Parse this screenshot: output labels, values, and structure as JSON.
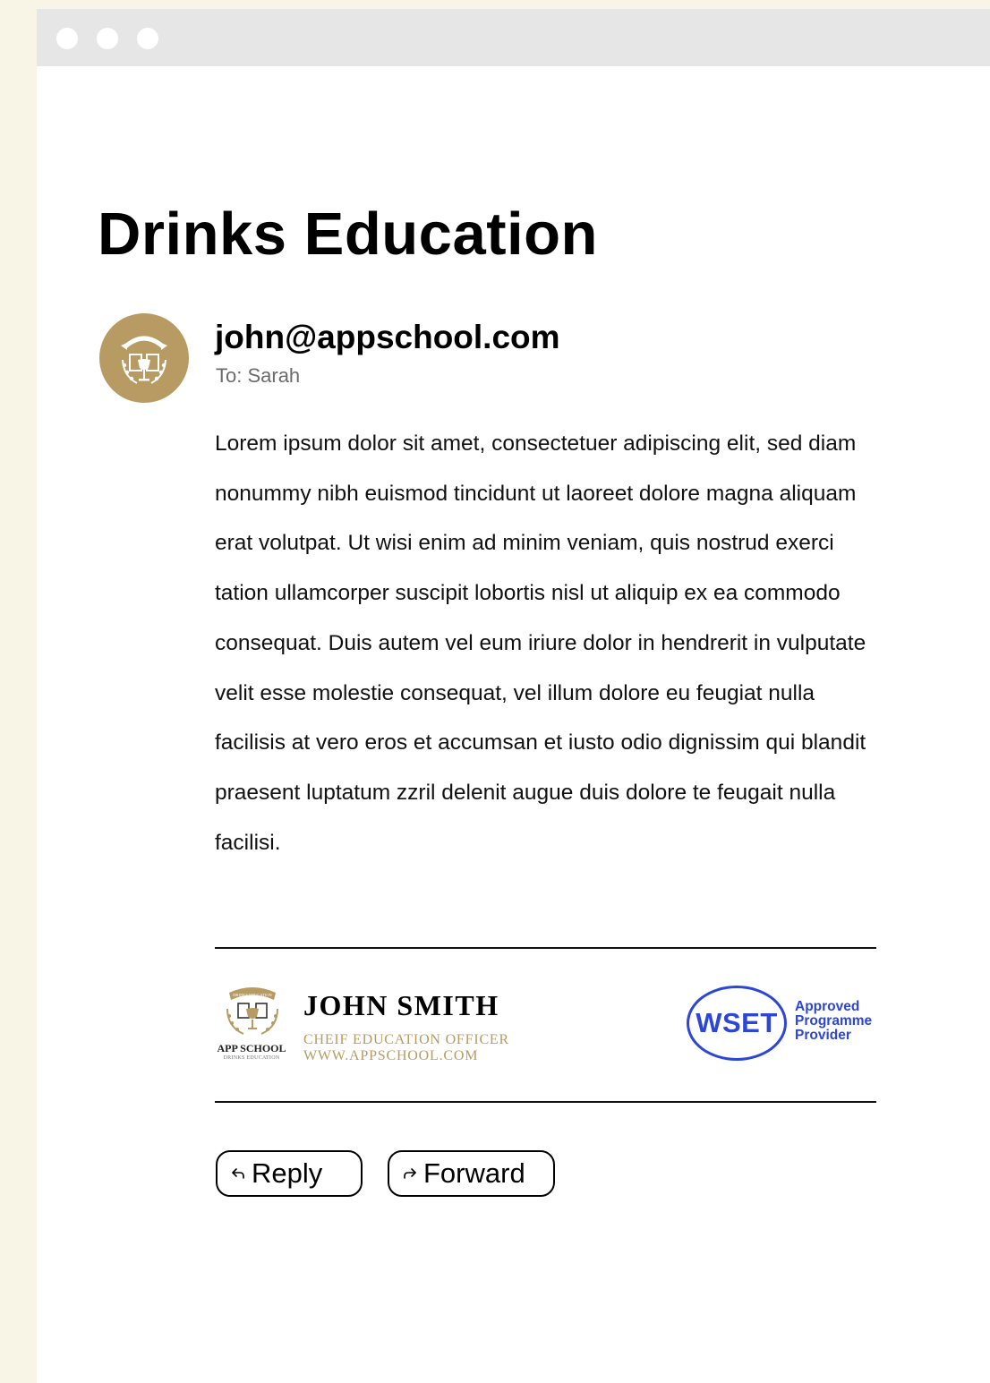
{
  "window": {
    "controls": [
      "window-dot",
      "window-dot",
      "window-dot"
    ]
  },
  "email": {
    "subject": "Drinks Education",
    "avatar_icon": "app-school-crest-icon",
    "sender": "john@appschool.com",
    "recipient": "To: Sarah",
    "body": "Lorem ipsum dolor sit amet, consectetuer adipiscing elit, sed diam nonummy nibh euismod tincidunt ut laoreet dolore magna aliquam erat volutpat. Ut wisi enim ad minim veniam, quis nostrud exerci tation ullamcorper suscipit lobortis nisl ut aliquip ex ea commodo consequat. Duis autem vel eum iriure dolor in hendrerit in vulputate velit esse molestie consequat, vel illum dolore eu feugiat nulla facilisis at vero eros et accumsan et iusto odio dignissim qui blandit praesent luptatum zzril delenit augue duis dolore te feugait nulla facilisi."
  },
  "signature": {
    "logo_brand": "APP SCHOOL",
    "logo_subtitle": "DRINKS EDUCATION",
    "logo_banner": "DRINKS EDUCATION",
    "name": "JOHN SMITH",
    "role": "CHEIF EDUCATION OFFICER",
    "website": "WWW.APPSCHOOL.COM",
    "badge": {
      "logo": "WSET",
      "lines": [
        "Approved",
        "Programme",
        "Provider"
      ]
    }
  },
  "actions": {
    "reply": {
      "label": "Reply",
      "icon": "reply-arrow-icon"
    },
    "forward": {
      "label": "Forward",
      "icon": "forward-arrow-icon"
    }
  },
  "colors": {
    "background": "#f8f4e6",
    "titlebar": "#e6e6e6",
    "accent_gold": "#b89b62",
    "wset_blue": "#2d46d6"
  }
}
